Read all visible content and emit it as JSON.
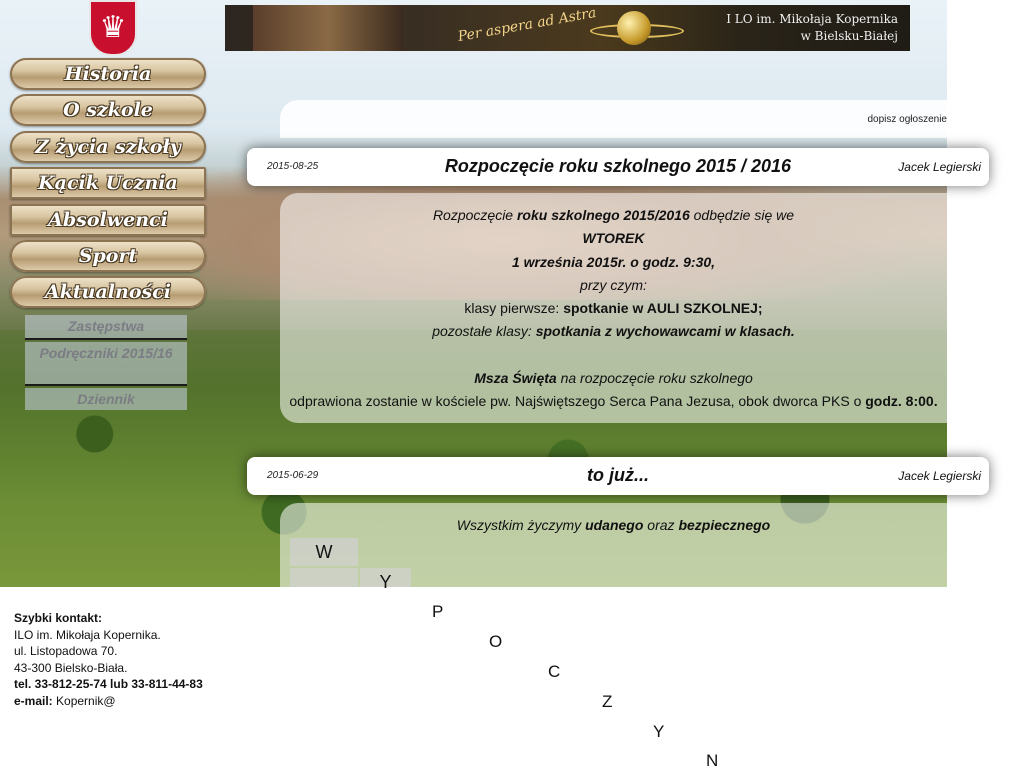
{
  "banner": {
    "motto": "Per aspera ad Astra",
    "school_line1": "I LO  im. Mikołaja Kopernika",
    "school_line2": "w Bielsku-Białej"
  },
  "menu": {
    "items": [
      {
        "label": "Historia"
      },
      {
        "label": "O szkole"
      },
      {
        "label": "Z życia szkoły"
      },
      {
        "label": "Kącik Ucznia"
      },
      {
        "label": "Absolwenci"
      },
      {
        "label": "Sport"
      },
      {
        "label": "Aktualności"
      }
    ],
    "submenu": [
      {
        "label": "Zastępstwa"
      },
      {
        "label": "Podręczniki 2015/16"
      },
      {
        "label": "Dziennik"
      }
    ]
  },
  "topbar": {
    "add_link": "dopisz ogłoszenie"
  },
  "posts": [
    {
      "date": "2015-08-25",
      "title": "Rozpoczęcie roku szkolnego 2015 / 2016",
      "author": "Jacek Legierski",
      "body": {
        "l1a": "Rozpoczęcie ",
        "l1b": "roku szkolnego 2015/2016",
        "l1c": " odbędzie się we",
        "l2": "WTOREK",
        "l3": "1 września 2015r. o godz. 9:30,",
        "l4": "przy czym:",
        "l5a": "klasy pierwsze: ",
        "l5b": "spotkanie w AULI SZKOLNEJ;",
        "l6a": "pozostałe klasy: ",
        "l6b": "spotkania z wychowawcami w klasach.",
        "l7a": "Msza Święta",
        "l7b": " na rozpoczęcie roku szkolnego",
        "l8a": "odprawiona zostanie w kościele pw. Najświętszego Serca Pana Jezusa, obok dworca PKS o ",
        "l8b": "godz. 8:00."
      }
    },
    {
      "date": "2015-06-29",
      "title": "to już...",
      "author": "Jacek Legierski",
      "body": {
        "l1a": "Wszystkim życzymy ",
        "l1b": "udanego",
        "l1c": " oraz ",
        "l1d": "bezpiecznego"
      }
    }
  ],
  "diagonal_letters": [
    "W",
    "Y",
    "P",
    "O",
    "C",
    "Z",
    "Y",
    "N"
  ],
  "contact": {
    "heading": "Szybki kontakt:",
    "line1": "ILO im. Mikołaja Kopernika.",
    "line2": "ul. Listopadowa 70.",
    "line3": "43-300 Bielsko-Biała.",
    "tel": "tel. 33-812-25-74 lub 33-811-44-83",
    "email_label": "e-mail:",
    "email_value": " Kopernik@"
  }
}
